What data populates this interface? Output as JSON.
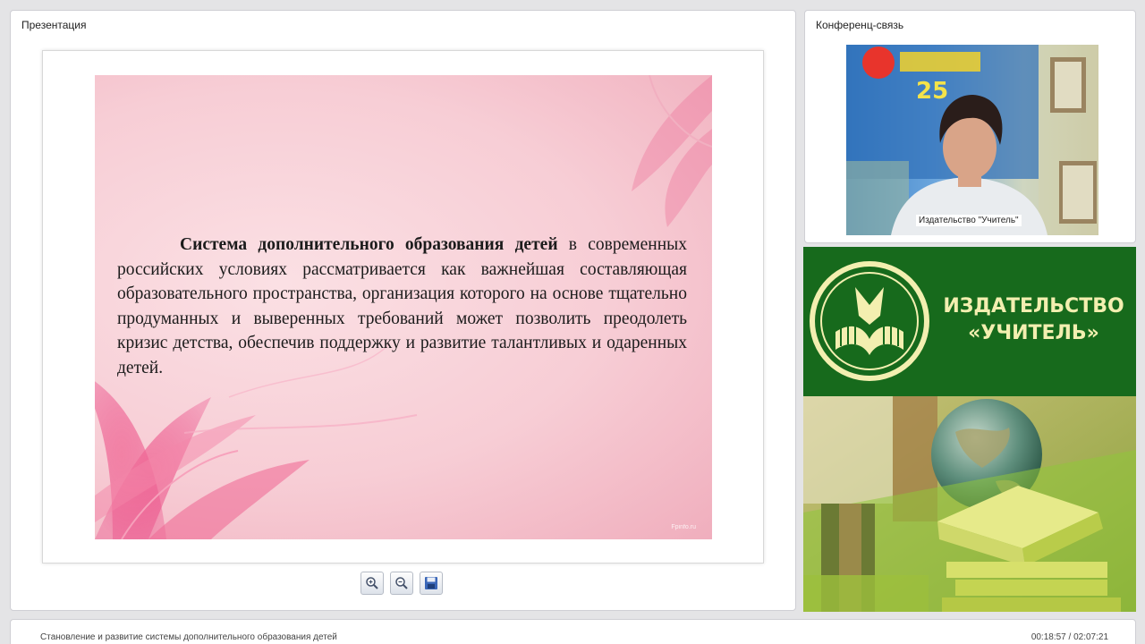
{
  "presentation": {
    "title": "Презентация",
    "slide_text_bold": "Система дополнительного образования детей",
    "slide_text_rest": " в современных российских условиях рассматривается как важнейшая составляющая образовательного пространства, организация которого на основе тщательно продуманных и выверенных требований может позволить преодолеть кризис детства, обеспечив поддержку и развитие талантливых и одаренных детей.",
    "slide_watermark": "Fpinfo.ru"
  },
  "toolbar": {
    "zoom_in_icon": "zoom-in-icon",
    "zoom_out_icon": "zoom-out-icon",
    "save_icon": "save-icon"
  },
  "conference": {
    "title": "Конференц-связь",
    "video_caption": "Издательство \"Учитель\""
  },
  "banner": {
    "line1": "ИЗДАТЕЛЬСТВО",
    "line2": "«УЧИТЕЛЬ»"
  },
  "bottom_bar": {
    "lecture_title": "Становление и развитие системы дополнительного образования детей",
    "timer": "00:18:57 / 02:07:21"
  },
  "colors": {
    "banner_green": "#176a1c",
    "banner_text": "#f3efb0",
    "slide_pink": "#f7cdd5"
  }
}
